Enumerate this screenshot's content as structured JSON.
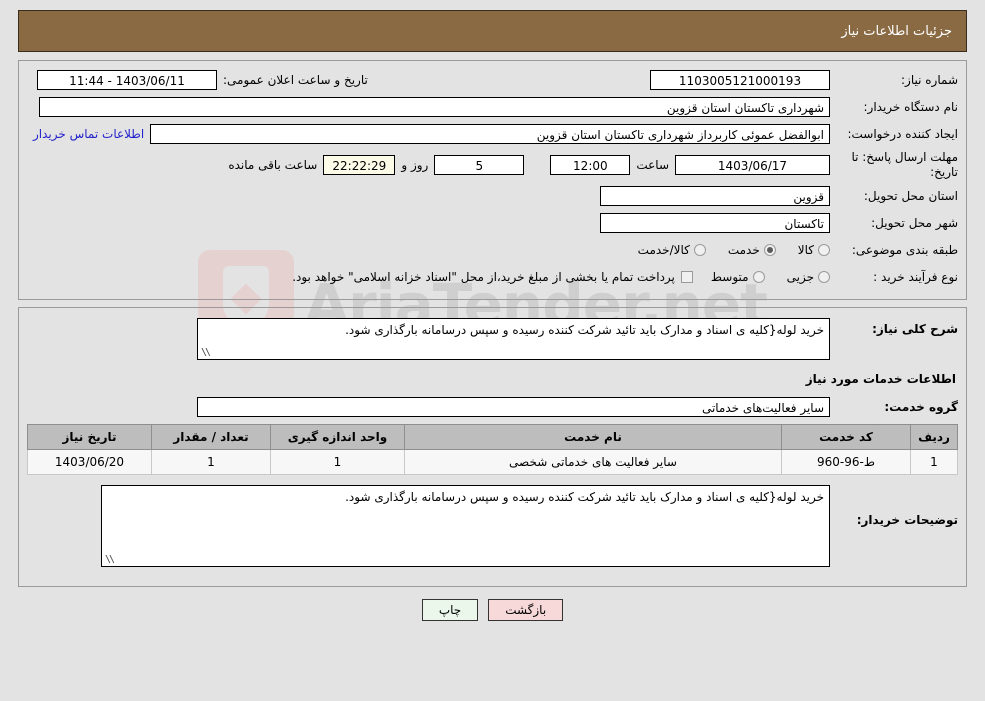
{
  "header": {
    "title": "جزئیات اطلاعات نیاز"
  },
  "watermark": {
    "text": "AriaTender.net"
  },
  "top_panel": {
    "need_number": {
      "label": "شماره نیاز:",
      "value": "1103005121000193"
    },
    "announce_datetime": {
      "label": "تاریخ و ساعت اعلان عمومی:",
      "value": "1403/06/11 - 11:44"
    },
    "buyer_org": {
      "label": "نام دستگاه خریدار:",
      "value": "شهرداری تاکستان استان قزوین"
    },
    "request_creator": {
      "label": "ایجاد کننده درخواست:",
      "value": "ابوالفضل عموئی کاربرداز شهرداری تاکستان استان قزوین"
    },
    "buyer_contact_link": "اطلاعات تماس خریدار",
    "deadline": {
      "label": "مهلت ارسال پاسخ: تا تاریخ:",
      "date": "1403/06/17",
      "hour_label": "ساعت",
      "hour": "12:00",
      "days": "5",
      "days_label": "روز و",
      "countdown": "22:22:29",
      "countdown_label": "ساعت باقی مانده"
    },
    "delivery_province": {
      "label": "استان محل تحویل:",
      "value": "قزوین"
    },
    "delivery_city": {
      "label": "شهر محل تحویل:",
      "value": "تاکستان"
    },
    "category": {
      "label": "طبقه بندی موضوعی:",
      "options": [
        {
          "label": "کالا",
          "selected": false
        },
        {
          "label": "خدمت",
          "selected": true
        },
        {
          "label": "کالا/خدمت",
          "selected": false
        }
      ]
    },
    "process_type": {
      "label": "نوع فرآیند خرید :",
      "options": [
        {
          "label": "جزیی",
          "selected": false
        },
        {
          "label": "متوسط",
          "selected": false
        }
      ],
      "checkbox_checked": false,
      "note": "پرداخت تمام یا بخشی از مبلغ خرید،از محل \"اسناد خزانه اسلامی\" خواهد بود."
    }
  },
  "mid_panel": {
    "general_description": {
      "label": "شرح کلی نیاز:",
      "value": "خرید لوله{کلیه ی اسناد و مدارک باید تائید شرکت کننده رسیده و سپس درسامانه بارگذاری شود."
    },
    "services_section_title": "اطلاعات خدمات مورد نیاز",
    "service_group": {
      "label": "گروه خدمت:",
      "value": "سایر فعالیت‌های خدماتی"
    },
    "table": {
      "columns": [
        "ردیف",
        "کد خدمت",
        "نام خدمت",
        "واحد اندازه گیری",
        "تعداد / مقدار",
        "تاریخ نیاز"
      ],
      "rows": [
        {
          "row_no": "1",
          "service_code": "ط-96-960",
          "service_name": "سایر فعالیت های خدماتی شخصی",
          "unit": "1",
          "quantity": "1",
          "need_date": "1403/06/20"
        }
      ]
    },
    "buyer_notes": {
      "label": "توضیحات خریدار:",
      "value": "خرید لوله{کلیه ی اسناد و مدارک باید تائید شرکت کننده رسیده و سپس درسامانه بارگذاری شود."
    }
  },
  "footer": {
    "print_button": "چاپ",
    "back_button": "بازگشت"
  }
}
